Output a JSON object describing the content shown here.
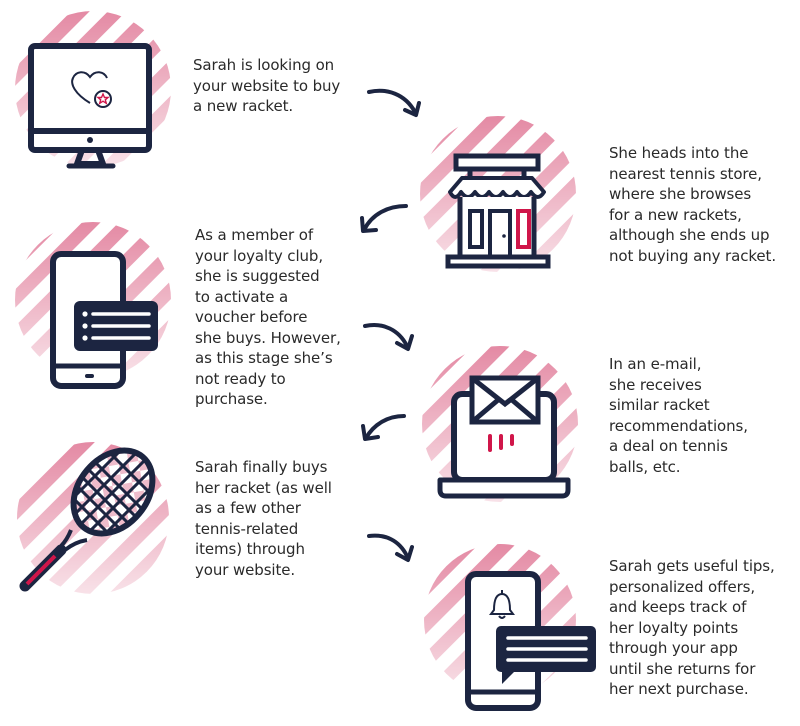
{
  "colors": {
    "navy": "#1c2541",
    "accent": "#d0164a",
    "stripe": "#e48aa4",
    "text": "#2a2a2a"
  },
  "steps": [
    {
      "icon": "monitor-heart-icon",
      "text": "Sarah is looking on\nyour website to buy\na new racket."
    },
    {
      "icon": "storefront-icon",
      "text": "She heads into the\nnearest tennis store,\nwhere she browses\nfor a new rackets,\nalthough she ends up\nnot buying any racket."
    },
    {
      "icon": "phone-voucher-icon",
      "text": "As a member of\nyour loyalty club,\nshe is suggested\nto activate a\nvoucher before\nshe buys. However,\nas this stage she’s\nnot ready to\npurchase."
    },
    {
      "icon": "laptop-email-icon",
      "text": "In an e-mail,\nshe receives\nsimilar racket\nrecommendations,\na deal on tennis\nballs, etc."
    },
    {
      "icon": "tennis-racket-icon",
      "text": "Sarah finally buys\nher racket (as well\nas a few other\ntennis-related\nitems) through\nyour website."
    },
    {
      "icon": "phone-notification-icon",
      "text": "Sarah gets useful tips,\npersonalized offers,\nand keeps track of\nher loyalty points\nthrough your app\nuntil she returns for\nher next purchase."
    }
  ],
  "arrows": [
    {
      "icon": "arrow-curved-right-down-icon"
    },
    {
      "icon": "arrow-curved-left-down-icon"
    },
    {
      "icon": "arrow-curved-right-down-icon"
    },
    {
      "icon": "arrow-curved-left-down-icon"
    },
    {
      "icon": "arrow-curved-right-down-icon"
    }
  ]
}
